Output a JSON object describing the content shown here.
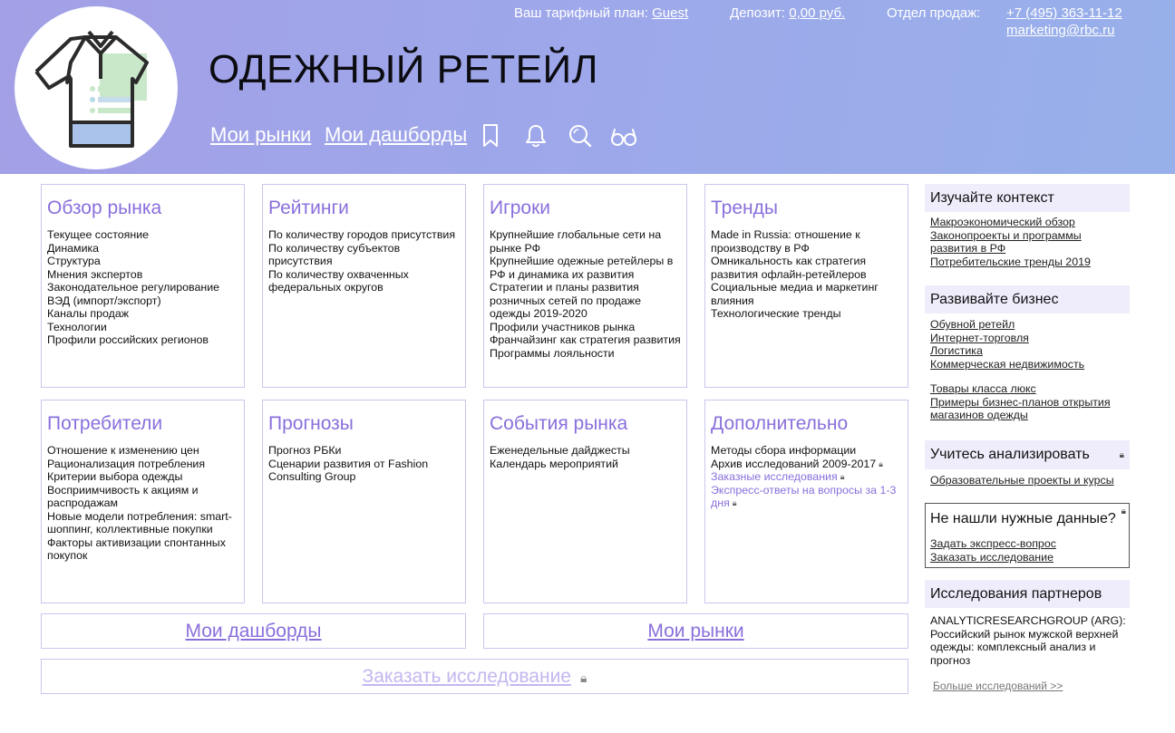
{
  "header": {
    "app_title": "ОДЕЖНЫЙ РЕТЕЙЛ",
    "tariff_label": "Ваш тарифный план:",
    "tariff_value": "Guest",
    "deposit_label": "Депозит:",
    "deposit_value": "0,00 руб.",
    "sales_label": "Отдел продаж:",
    "sales_phone": "+7 (495) 363-11-12",
    "sales_email": "marketing@rbc.ru",
    "nav": {
      "my_markets": "Мои рынки",
      "my_dashboards": "Мои дашборды"
    },
    "icons": [
      "bookmark-icon",
      "bell-icon",
      "search-icon",
      "glasses-icon"
    ]
  },
  "cards": {
    "overview": {
      "title": "Обзор рынка",
      "items": [
        "Текущее состояние",
        "Динамика",
        "Структура",
        "Мнения экспертов",
        "Законодательное регулирование",
        "ВЭД (импорт/экспорт)",
        "Каналы продаж",
        "Технологии",
        "Профили российских регионов"
      ]
    },
    "ratings": {
      "title": "Рейтинги",
      "items": [
        "По количеству городов присутствия",
        "По количеству субъектов присутствия",
        "По количеству охваченных федеральных округов"
      ]
    },
    "players": {
      "title": "Игроки",
      "items": [
        "Крупнейшие глобальные сети на рынке РФ",
        "Крупнейшие одежные ретейлеры в РФ и динамика их развития",
        "Стратегии и планы развития розничных сетей по продаже одежды 2019-2020",
        "Профили участников рынка",
        "Франчайзинг как стратегия развития",
        "Программы лояльности"
      ]
    },
    "trends": {
      "title": "Тренды",
      "items": [
        "Made in Russia: отношение к производству в РФ",
        "Омникальность как стратегия развития офлайн-ретейлеров",
        "Социальные медиа и маркетинг влияния",
        "Технологические тренды"
      ]
    },
    "consumers": {
      "title": "Потребители",
      "items": [
        "Отношение к изменению цен",
        "Рационализация потребления",
        "Критерии выбора одежды",
        "Восприимчивость к акциям и распродажам",
        "Новые модели потребления: smart-шоппинг, коллективные покупки",
        "Факторы активизации спонтанных покупок"
      ]
    },
    "forecasts": {
      "title": "Прогнозы",
      "items": [
        "Прогноз РБКи",
        "Сценарии развития от Fashion Consulting Group"
      ]
    },
    "events": {
      "title": "События рынка",
      "items": [
        "Еженедельные дайджесты",
        "Календарь мероприятий"
      ]
    },
    "additional": {
      "title": "Дополнительно",
      "items": [
        "Методы сбора информации",
        "Архив исследований 2009-2017",
        "Заказные исследования",
        "Экспресс-ответы на вопросы за 1-3 дня"
      ]
    }
  },
  "bottom": {
    "my_dashboards": "Мои дашборды",
    "my_markets": "Мои рынки",
    "order_research": "Заказать исследование"
  },
  "sidebar": {
    "context": {
      "title": "Изучайте контекст",
      "links": [
        "Макроэкономический обзор",
        "Законопроекты и программы развития в РФ",
        "Потребительские тренды 2019"
      ]
    },
    "business": {
      "title": "Развивайте бизнес",
      "links": [
        "Обувной ретейл",
        "Интернет-торговля",
        "Логистика",
        "Коммерческая недвижимость"
      ],
      "links2": [
        "Товары класса люкс",
        "Примеры бизнес-планов открытия магазинов одежды"
      ]
    },
    "learn": {
      "title": "Учитесь анализировать",
      "links": [
        "Образовательные проекты и курсы"
      ]
    },
    "missing": {
      "title": "Не нашли нужные данные?",
      "links": [
        "Задать экспресс-вопрос",
        "Заказать исследование"
      ]
    },
    "partners": {
      "title": "Исследования партнеров",
      "text": "ANALYTICRESEARCHGROUP (ARG): Российский рынок мужской верхней одежды: комплексный анализ и прогноз",
      "more": "Больше исследований >>"
    }
  },
  "colors": {
    "accent": "#8a6fdc",
    "header_start": "#a39fe6",
    "header_end": "#97b0ea",
    "card_border": "#c9c7ee",
    "side_head_bg": "#efedfb"
  }
}
